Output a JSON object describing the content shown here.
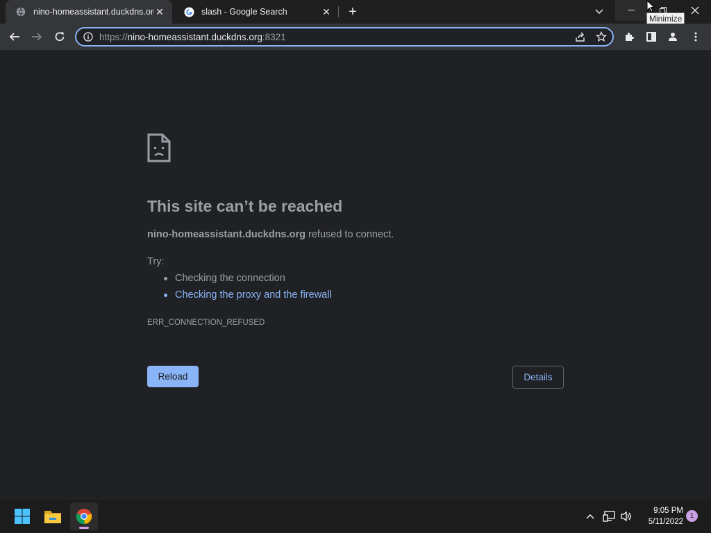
{
  "browser": {
    "tabs": [
      {
        "title": "nino-homeassistant.duckdns.org",
        "active": true,
        "favicon": "globe-icon"
      },
      {
        "title": "slash - Google Search",
        "active": false,
        "favicon": "google-icon"
      }
    ],
    "tooltip": "Minimize",
    "url": {
      "scheme": "https://",
      "host": "nino-homeassistant.duckdns.org",
      "port": ":8321"
    }
  },
  "error_page": {
    "title": "This site can’t be reached",
    "host": "nino-homeassistant.duckdns.org",
    "description_suffix": " refused to connect.",
    "try_label": "Try:",
    "suggestions": [
      {
        "text": "Checking the connection",
        "link": false
      },
      {
        "text": "Checking the proxy and the firewall",
        "link": true
      }
    ],
    "error_code": "ERR_CONNECTION_REFUSED",
    "reload_label": "Reload",
    "details_label": "Details"
  },
  "taskbar": {
    "time": "9:05 PM",
    "date": "5/11/2022",
    "notification_count": "1",
    "apps": [
      "windows-start-icon",
      "file-explorer-icon",
      "chrome-icon"
    ]
  },
  "colors": {
    "accent": "#8ab4f8",
    "background": "#202124",
    "text": "#9aa0a6"
  }
}
